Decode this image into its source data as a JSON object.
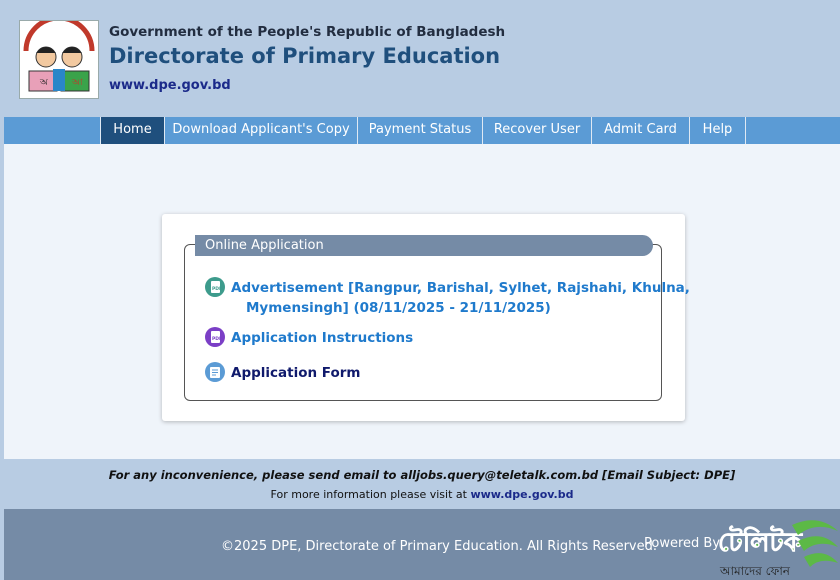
{
  "header": {
    "government": "Government of the People's Republic of Bangladesh",
    "title": "Directorate of Primary Education",
    "url": "www.dpe.gov.bd",
    "logo_icon": "dpe-children-reading-logo"
  },
  "nav": {
    "items": [
      {
        "label": "Home",
        "active": true
      },
      {
        "label": "Download Applicant's Copy",
        "active": false
      },
      {
        "label": "Payment Status",
        "active": false
      },
      {
        "label": "Recover User",
        "active": false
      },
      {
        "label": "Admit Card",
        "active": false
      },
      {
        "label": "Help",
        "active": false
      }
    ]
  },
  "main": {
    "panel_title": "Online Application",
    "links": [
      {
        "line1": "Advertisement [Rangpur, Barishal, Sylhet, Rajshahi, Khulna,",
        "line2": "Mymensingh] (08/11/2025 - 21/11/2025)",
        "icon": "pdf-icon"
      },
      {
        "label": "Application Instructions",
        "icon": "pdf-icon"
      },
      {
        "label": "Application Form",
        "icon": "form-icon"
      }
    ]
  },
  "notice": {
    "line1": "For any inconvenience, please send email to alljobs.query@teletalk.com.bd [Email Subject: DPE]",
    "line2_prefix": "For more information please visit at",
    "line2_link": "www.dpe.gov.bd"
  },
  "footer": {
    "copyright": "©2025 DPE, Directorate of Primary Education. All Rights Reserved.",
    "powered_by": "Powered By",
    "teletalk_logo_text": "টেলিটক",
    "teletalk_tagline": "আমাদের ফোন"
  },
  "colors": {
    "header_bg": "#b8cce3",
    "nav_bg": "#5b9bd5",
    "nav_active": "#1f4f7d",
    "legend_bg": "#758ba6",
    "link": "#1f7acc",
    "footer_bg": "#758ba6",
    "teletalk_green": "#5cb946"
  }
}
